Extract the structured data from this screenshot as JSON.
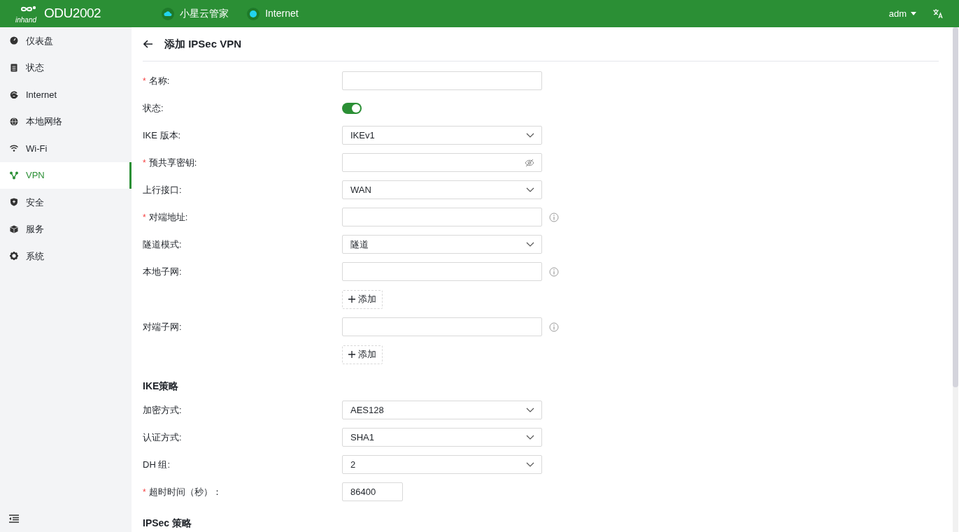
{
  "header": {
    "logo_text": "inhand",
    "product": "ODU2002",
    "status": [
      {
        "kind": "cloud",
        "label": "小星云管家"
      },
      {
        "kind": "dot",
        "label": "Internet"
      }
    ],
    "user": "adm"
  },
  "sidebar": {
    "items": [
      {
        "label": "仪表盘",
        "selected": false
      },
      {
        "label": "状态",
        "selected": false
      },
      {
        "label": "Internet",
        "selected": false
      },
      {
        "label": "本地网络",
        "selected": false
      },
      {
        "label": "Wi-Fi",
        "selected": false
      },
      {
        "label": "VPN",
        "selected": true
      },
      {
        "label": "安全",
        "selected": false
      },
      {
        "label": "服务",
        "selected": false
      },
      {
        "label": "系统",
        "selected": false
      }
    ]
  },
  "page": {
    "title": "添加 IPSec VPN"
  },
  "form": [
    {
      "kind": "text",
      "marker": "*",
      "label": "名称:"
    },
    {
      "kind": "switch",
      "label": "状态:",
      "on": true
    },
    {
      "kind": "select",
      "label": "IKE 版本:",
      "value": "IKEv1"
    },
    {
      "kind": "password",
      "marker": "*",
      "label": "预共享密钥:"
    },
    {
      "kind": "select",
      "label": "上行接口:",
      "value": "WAN"
    },
    {
      "kind": "text",
      "marker": "*",
      "label": "对端地址:",
      "info": true
    },
    {
      "kind": "select",
      "label": "隧道模式:",
      "value": "隧道"
    },
    {
      "kind": "text",
      "label": "本地子网:",
      "info": true
    },
    {
      "kind": "add",
      "label": "添加"
    },
    {
      "kind": "text",
      "label": "对端子网:",
      "info": true
    },
    {
      "kind": "add",
      "label": "添加"
    },
    {
      "kind": "heading",
      "label": "IKE策略"
    },
    {
      "kind": "select",
      "label": "加密方式:",
      "value": "AES128"
    },
    {
      "kind": "select",
      "label": "认证方式:",
      "value": "SHA1"
    },
    {
      "kind": "select",
      "label": "DH 组:",
      "value": "2"
    },
    {
      "kind": "short",
      "marker": "*",
      "label": "超时时间（秒）：",
      "value": "86400"
    },
    {
      "kind": "heading",
      "label": "IPSec 策略"
    }
  ]
}
